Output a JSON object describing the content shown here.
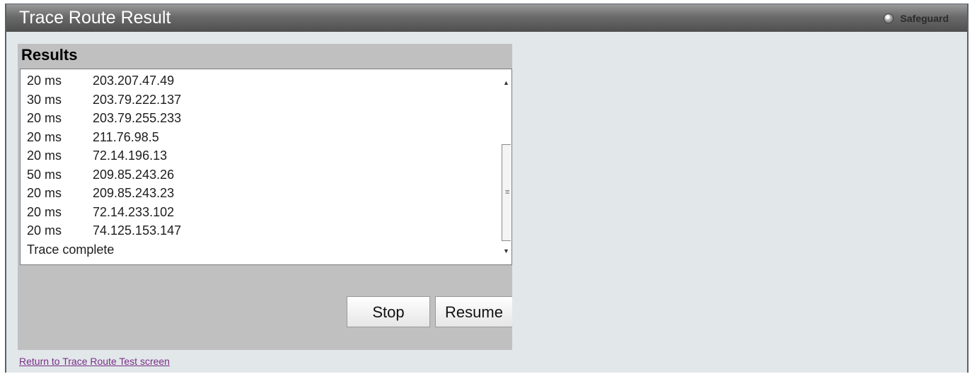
{
  "window": {
    "title": "Trace Route Result",
    "safeguard_label": "Safeguard"
  },
  "results": {
    "header": "Results",
    "rows": [
      {
        "time": "20 ms",
        "ip": "203.207.47.49"
      },
      {
        "time": "30 ms",
        "ip": "203.79.222.137"
      },
      {
        "time": "20 ms",
        "ip": "203.79.255.233"
      },
      {
        "time": "20 ms",
        "ip": "211.76.98.5"
      },
      {
        "time": "20 ms",
        "ip": "72.14.196.13"
      },
      {
        "time": "50 ms",
        "ip": "209.85.243.26"
      },
      {
        "time": "20 ms",
        "ip": "209.85.243.23"
      },
      {
        "time": "20 ms",
        "ip": "72.14.233.102"
      },
      {
        "time": "20 ms",
        "ip": "74.125.153.147"
      }
    ],
    "status": "Trace complete"
  },
  "buttons": {
    "stop": "Stop",
    "resume": "Resume"
  },
  "links": {
    "return": "Return to Trace Route Test screen"
  },
  "colors": {
    "background": "#e2e7ea",
    "panel": "#c0c0c0",
    "link": "#7a2f87"
  }
}
